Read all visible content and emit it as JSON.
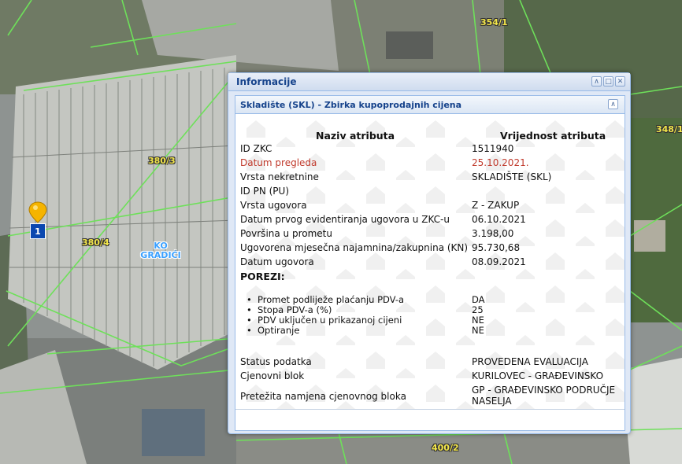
{
  "map": {
    "parcel_labels": [
      "354/1",
      "348/1",
      "380/3",
      "380/4",
      "400/2"
    ],
    "ko_label_line1": "KO",
    "ko_label_line2": "GRADIĆI",
    "marker_number": "1",
    "colors": {
      "parcel_line": "#6ee05a",
      "parcel_label": "#f2e54a",
      "ko_label": "#3aa0ff",
      "marker_pin": "#f5b400",
      "marker_box": "#0a47b0"
    }
  },
  "popup": {
    "title": "Informacije",
    "panel_title": "Skladište (SKL) - Zbirka kupoprodajnih cijena",
    "column_headers": {
      "name": "Naziv atributa",
      "value": "Vrijednost atributa"
    },
    "rows": [
      {
        "name": "ID ZKC",
        "value": "1511940"
      },
      {
        "name": "Datum pregleda",
        "value": "25.10.2021."
      },
      {
        "name": "Vrsta nekretnine",
        "value": "SKLADIŠTE (SKL)"
      },
      {
        "name": "ID PN (PU)",
        "value": ""
      },
      {
        "name": "Vrsta ugovora",
        "value": "Z - ZAKUP"
      },
      {
        "name": "Datum prvog evidentiranja ugovora u ZKC-u",
        "value": "06.10.2021"
      },
      {
        "name": "Površina u prometu",
        "value": "3.198,00"
      },
      {
        "name": "Ugovorena mjesečna najamnina/zakupnina (KN)",
        "value": "95.730,68"
      },
      {
        "name": "Datum ugovora",
        "value": "08.09.2021"
      }
    ],
    "porezi_label": "POREZI:",
    "porezi": [
      {
        "name": "Promet podliježe plaćanju PDV-a",
        "value": "DA"
      },
      {
        "name": "Stopa PDV-a (%)",
        "value": "25"
      },
      {
        "name": "PDV uključen u prikazanoj cijeni",
        "value": "NE"
      },
      {
        "name": "Optiranje",
        "value": "NE"
      }
    ],
    "rows2": [
      {
        "name": "Status podatka",
        "value": "PROVEDENA EVALUACIJA"
      },
      {
        "name": "Cjenovni blok",
        "value": "KURILOVEC - GRAĐEVINSKO"
      },
      {
        "name": "Pretežita namjena cjenovnog bloka",
        "value_line1": "GP - GRAĐEVINSKO PODRUČJE",
        "value_line2": "NASELJA"
      }
    ],
    "highlight_color": "#c0392b",
    "tools": [
      "collapse-up-icon",
      "maximize-icon",
      "close-icon"
    ]
  }
}
